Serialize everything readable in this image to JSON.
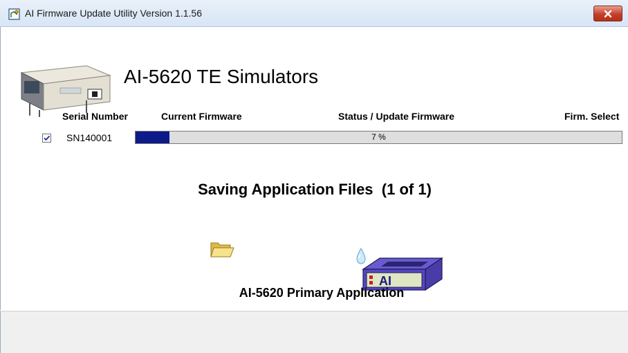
{
  "window": {
    "title": "AI Firmware Update Utility Version 1.1.56"
  },
  "main": {
    "heading": "AI-5620 TE Simulators",
    "columns": {
      "serial_number": "Serial Number",
      "current_firmware": "Current Firmware",
      "status": "Status / Update Firmware",
      "firm_select": "Firm. Select"
    },
    "rows": [
      {
        "checked": true,
        "serial": "SN140001",
        "progress": 0.07,
        "progress_text": "7 %"
      }
    ],
    "status_line": {
      "action": "Saving Application Files",
      "count": "(1 of 1)"
    },
    "application_label": "AI-5620 Primary Application"
  },
  "icons": {
    "app": "firmware-app-icon",
    "close": "close-icon",
    "device": "device-image",
    "folder": "folder-icon",
    "drop": "water-drop-icon",
    "chip": "ai-chip-icon"
  },
  "colors": {
    "progress_fill": "#0d1a8a",
    "progress_track": "#dedede",
    "close_button": "#c4402a"
  }
}
